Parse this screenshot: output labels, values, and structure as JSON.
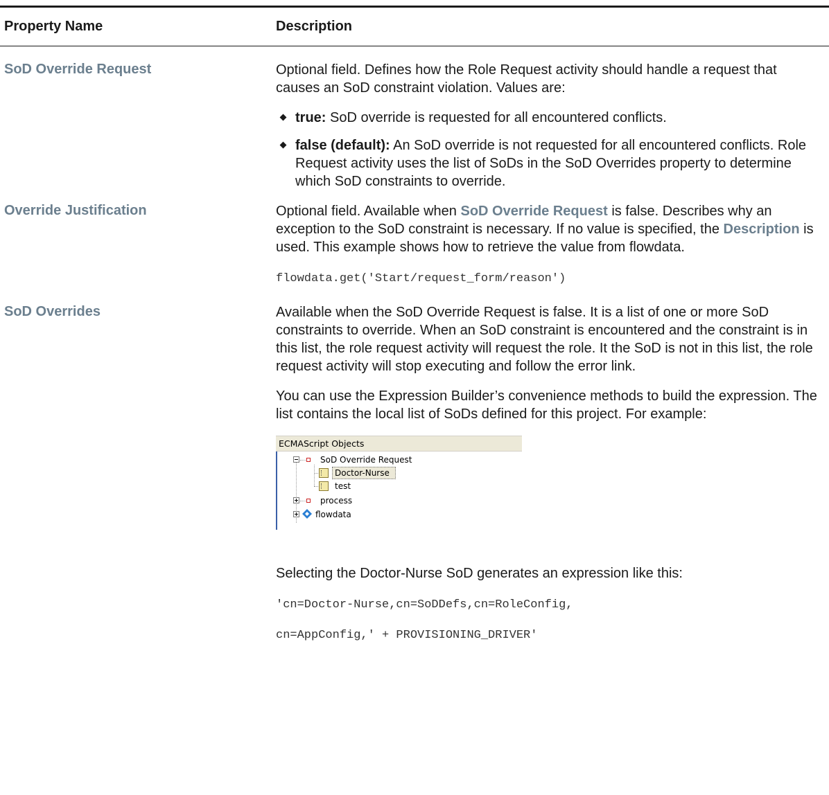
{
  "table": {
    "headers": {
      "name": "Property Name",
      "description": "Description"
    },
    "rows": {
      "sod_override_request": {
        "name": "SoD Override Request",
        "intro": "Optional field. Defines how the Role Request activity should handle a request that causes an SoD constraint violation. Values are:",
        "bullets": [
          {
            "term": "true:",
            "text": " SoD override is requested for all encountered conflicts."
          },
          {
            "term": "false (default):",
            "text": "  An SoD override is not requested for all encountered conflicts. Role Request activity uses the list of SoDs in the SoD Overrides property to determine which SoD constraints to override."
          }
        ]
      },
      "override_justification": {
        "name": "Override Justification",
        "text_1": "Optional field. Available when ",
        "link_1": "SoD Override Request",
        "text_2": " is false. Describes why an exception to the SoD constraint is necessary. If no value is specified, the ",
        "link_2": "Description",
        "text_3": " is used. This example shows how to retrieve the value from flowdata.",
        "code": "flowdata.get('Start/request_form/reason')"
      },
      "sod_overrides": {
        "name": "SoD Overrides",
        "para_1": "Available when the SoD Override Request is false. It is a list of one or more SoD constraints to override. When an SoD constraint is encountered and the constraint is in this list, the role request activity will request the role. It the SoD is not in this list, the role request activity will stop executing and follow the error link.",
        "para_2": "You can use the Expression Builder’s convenience methods to build the expression. The list contains the local list of SoDs defined for this project. For example:",
        "screenshot": {
          "title": "ECMAScript Objects",
          "tree": {
            "root": "SoD Override Request",
            "children": [
              "Doctor-Nurse",
              "test"
            ],
            "process": "process",
            "flowdata": "flowdata"
          }
        },
        "para_3": "Selecting the Doctor-Nurse SoD generates an expression like this:",
        "code_1": "'cn=Doctor-Nurse,cn=SoDDefs,cn=RoleConfig,",
        "code_2": "cn=AppConfig,' + PROVISIONING_DRIVER'"
      }
    }
  },
  "colors": {
    "term_link": "#6b7f8e",
    "text": "#1a1a1a"
  }
}
